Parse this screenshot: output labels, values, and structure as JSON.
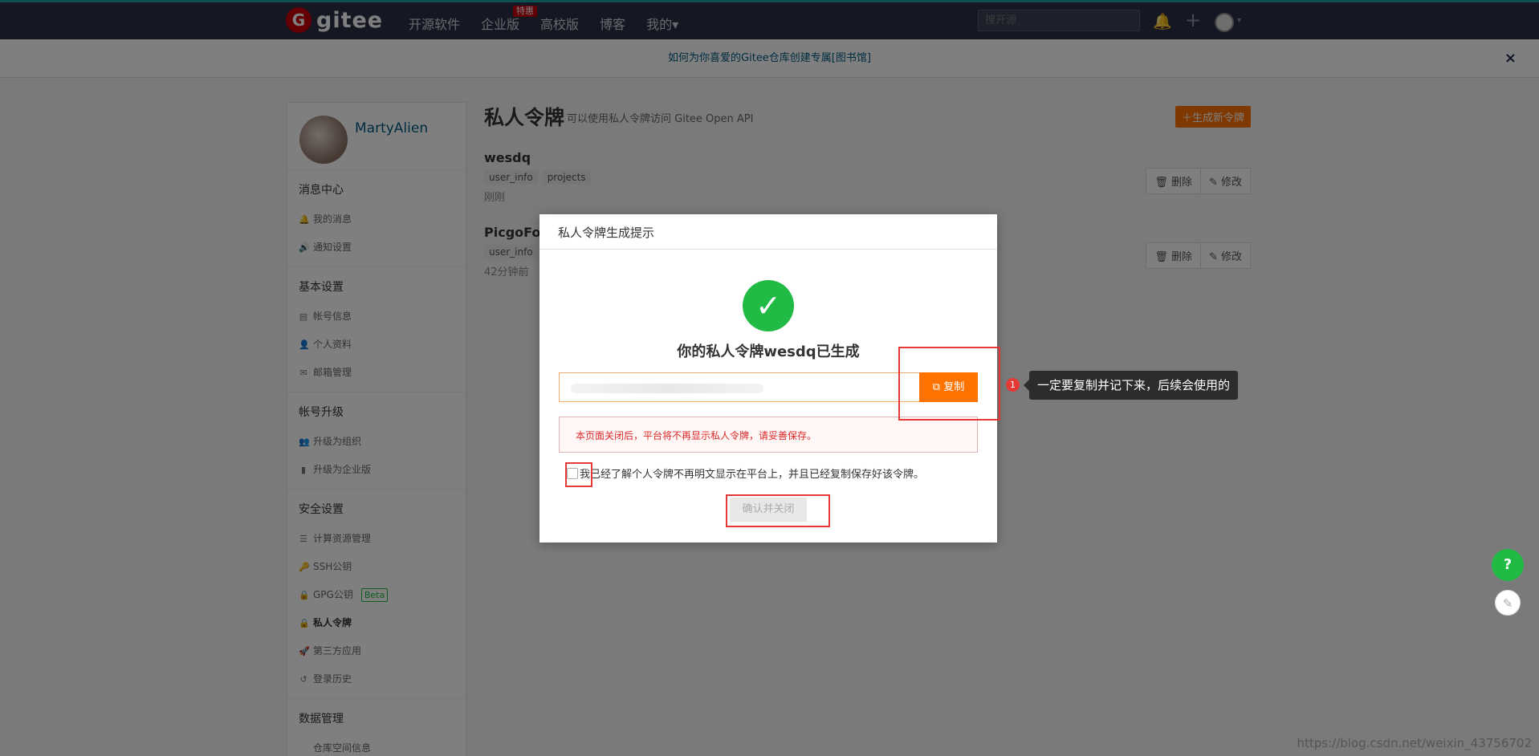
{
  "topnav": {
    "logo_mark": "G",
    "logo_text": "gitee",
    "links": [
      "开源软件",
      "企业版",
      "高校版",
      "博客",
      "我的▾"
    ],
    "badge": "特惠",
    "search_placeholder": "搜开源",
    "bell": "🔔",
    "plus": "+",
    "caret": "▾"
  },
  "notice": {
    "text": "如何为你喜爱的Gitee仓库创建专属[图书馆]",
    "close": "×"
  },
  "sidebar": {
    "username": "MartyAlien",
    "groups": [
      {
        "title": "消息中心",
        "items": [
          {
            "icon": "🔔",
            "label": "我的消息"
          },
          {
            "icon": "🔊",
            "label": "通知设置"
          }
        ]
      },
      {
        "title": "基本设置",
        "items": [
          {
            "icon": "▤",
            "label": "帐号信息"
          },
          {
            "icon": "👤",
            "label": "个人资料"
          },
          {
            "icon": "✉",
            "label": "邮箱管理"
          }
        ]
      },
      {
        "title": "帐号升级",
        "items": [
          {
            "icon": "👥",
            "label": "升级为组织"
          },
          {
            "icon": "▮",
            "label": "升级为企业版"
          }
        ]
      },
      {
        "title": "安全设置",
        "items": [
          {
            "icon": "☰",
            "label": "计算资源管理"
          },
          {
            "icon": "🔑",
            "label": "SSH公钥"
          },
          {
            "icon": "🔒",
            "label": "GPG公钥",
            "badge": "Beta"
          },
          {
            "icon": "🔒",
            "label": "私人令牌"
          },
          {
            "icon": "🚀",
            "label": "第三方应用"
          },
          {
            "icon": "↺",
            "label": "登录历史"
          }
        ]
      },
      {
        "title": "数据管理",
        "items": [
          {
            "icon": "",
            "label": "仓库空间信息"
          }
        ]
      }
    ]
  },
  "main": {
    "title": "私人令牌",
    "subtitle": "可以使用私人令牌访问 Gitee Open API",
    "generate_button": "＋生成新令牌",
    "tokens": [
      {
        "name": "wesdq",
        "tags": [
          "user_info",
          "projects"
        ],
        "time": "刚刚"
      },
      {
        "name": "PicgoFork",
        "tags": [
          "user_info"
        ],
        "time": "42分钟前"
      }
    ],
    "delete_label": "🗑 删除",
    "edit_label": "✎ 修改"
  },
  "modal": {
    "header": "私人令牌生成提示",
    "success_check": "✓",
    "success_title": "你的私人令牌wesdq已生成",
    "copy_button": "⧉ 复制",
    "warning": "本页面关闭后，平台将不再显示私人令牌，请妥善保存。",
    "checkbox_label": "我已经了解个人令牌不再明文显示在平台上，并且已经复制保存好该令牌。",
    "confirm_button": "确认并关闭"
  },
  "callout": {
    "number": "1",
    "text": "一定要复制并记下来，后续会使用的"
  },
  "floating": {
    "help": "?",
    "edit": "✎"
  },
  "watermark": "https://blog.csdn.net/weixin_43756702"
}
